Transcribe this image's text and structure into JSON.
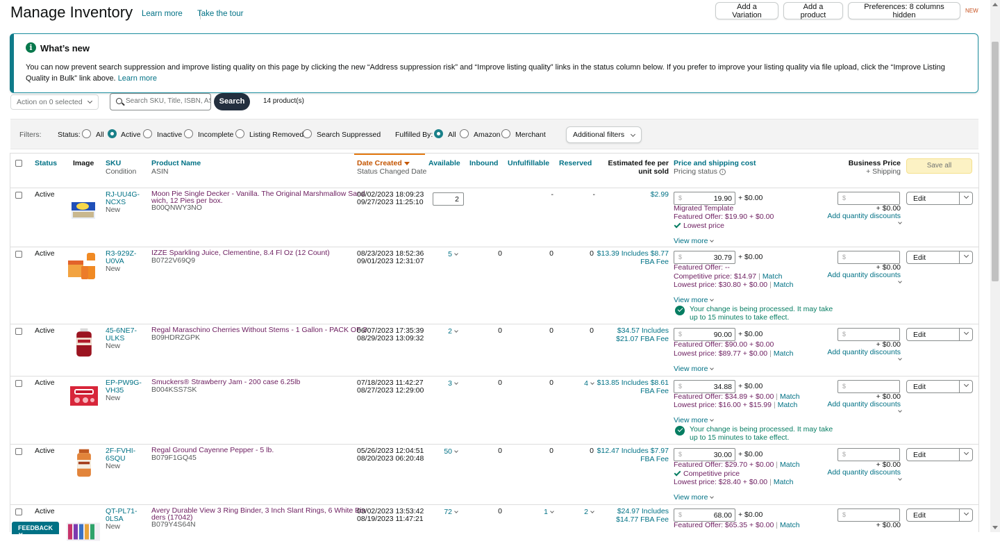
{
  "header": {
    "title": "Manage Inventory",
    "learn_more": "Learn more",
    "take_tour": "Take the tour",
    "add_variation": "Add a Variation",
    "add_product": "Add a product",
    "preferences": "Preferences: 8 columns hidden",
    "new_badge": "NEW"
  },
  "whats_new": {
    "title": "What’s new",
    "body": "You can now prevent search suppression and improve listing quality on this page by clicking the new “Address suppression risk” and “Improve listing quality” links in the status column below. If you prefer to improve your listing quality via file upload, click the “Improve Listing Quality in Bulk” link above.",
    "learn_more": "Learn more"
  },
  "toolbar": {
    "action_select": "Action on 0 selected",
    "search_placeholder": "Search SKU, Title, ISBN, ASIN",
    "search_button": "Search",
    "product_count": "14 product(s)"
  },
  "filters": {
    "label": "Filters:",
    "status_label": "Status:",
    "status_options": [
      "All",
      "Active",
      "Inactive",
      "Incomplete",
      "Listing Removed",
      "Search Suppressed"
    ],
    "status_selected": "Active",
    "fulfilled_label": "Fulfilled By:",
    "fulfilled_options": [
      "All",
      "Amazon",
      "Merchant"
    ],
    "fulfilled_selected": "All",
    "additional_filters": "Additional filters"
  },
  "table": {
    "headers": {
      "status": "Status",
      "image": "Image",
      "sku": "SKU",
      "sku_sub": "Condition",
      "product_name": "Product Name",
      "product_sub": "ASIN",
      "date_created": "Date Created",
      "date_sub": "Status Changed Date",
      "available": "Available",
      "inbound": "Inbound",
      "unfulfillable": "Unfulfillable",
      "reserved": "Reserved",
      "fee_line1": "Estimated fee per",
      "fee_line2": "unit sold",
      "price": "Price and shipping cost",
      "price_sub": "Pricing status",
      "business_price": "Business Price",
      "business_sub": "+ Shipping",
      "save_all": "Save all"
    },
    "rows": [
      {
        "status": "Active",
        "sku1": "RJ-UU4G-",
        "sku2": "NCXS",
        "condition": "New",
        "name1": "Moon Pie Single Decker - Vanilla. The Original Marshmallow Sand",
        "name2": "wich, 12 Pies per box.",
        "asin": "B00QNWY3NO",
        "date_created": "08/02/2023 18:09:23",
        "date_changed": "09/27/2023 11:25:10",
        "available": "2",
        "inbound": "",
        "unfulfillable": "-",
        "reserved": "-",
        "fee1": "$2.99",
        "fee2": "",
        "price": "19.90",
        "shipping": "+ $0.00",
        "line1": "Migrated Template",
        "line2": "Featured Offer: $19.90 + $0.00",
        "line3": "Lowest price",
        "view_more": "View more",
        "business_shipping": "+ $0.00",
        "add_qty": "Add quantity discounts",
        "edit": "Edit"
      },
      {
        "status": "Active",
        "sku1": "R3-929Z-",
        "sku2": "U0VA",
        "condition": "New",
        "name1": "IZZE Sparkling Juice, Clementine, 8.4 Fl Oz (12 Count)",
        "name2": "",
        "asin": "B0722V69Q9",
        "date_created": "08/23/2023 18:52:36",
        "date_changed": "09/01/2023 12:31:07",
        "available": "5",
        "inbound": "0",
        "unfulfillable": "0",
        "reserved": "0",
        "fee1": "$13.39 Includes $8.77",
        "fee2": "FBA Fee",
        "price": "30.79",
        "shipping": "+ $0.00",
        "line1": "Featured Offer: --",
        "line2": "Competitive price: $14.97",
        "line3": "Lowest price: $30.80 + $0.00",
        "match": "Match",
        "view_more": "View more",
        "processing1": "Your change is being processed. It may take",
        "processing2": "up to 15 minutes to take effect.",
        "business_shipping": "+ $0.00",
        "add_qty": "Add quantity discounts",
        "edit": "Edit"
      },
      {
        "status": "Active",
        "sku1": "45-6NE7-",
        "sku2": "ULKS",
        "condition": "New",
        "name1": "Regal Maraschino Cherries Without Stems - 1 Gallon - PACK OF 3",
        "name2": "",
        "asin": "B09HDRZGPK",
        "date_created": "06/07/2023 17:35:39",
        "date_changed": "08/29/2023 13:09:32",
        "available": "2",
        "inbound": "0",
        "unfulfillable": "0",
        "reserved": "0",
        "fee1": "$34.57 Includes",
        "fee2": "$21.07 FBA Fee",
        "price": "90.00",
        "shipping": "+ $0.00",
        "line1": "Featured Offer: $90.00 + $0.00",
        "line2": "Lowest price: $89.77 + $0.00",
        "match": "Match",
        "view_more": "View more",
        "business_shipping": "+ $0.00",
        "add_qty": "Add quantity discounts",
        "edit": "Edit"
      },
      {
        "status": "Active",
        "sku1": "EP-PW9G-",
        "sku2": "VH35",
        "condition": "New",
        "name1": "Smuckers® Strawberry Jam - 200 case 6.25lb",
        "name2": "",
        "asin": "B004KSS7SK",
        "date_created": "07/18/2023 11:42:27",
        "date_changed": "08/27/2023 12:29:00",
        "available": "3",
        "inbound": "0",
        "unfulfillable": "0",
        "reserved": "4",
        "fee1": "$13.85 Includes $8.61",
        "fee2": "FBA Fee",
        "price": "34.88",
        "shipping": "+ $0.00",
        "line1": "Featured Offer: $34.89 + $0.00",
        "line2": "Lowest price: $16.00 + $15.99",
        "match": "Match",
        "view_more": "View more",
        "processing1": "Your change is being processed. It may take",
        "processing2": "up to 15 minutes to take effect.",
        "business_shipping": "+ $0.00",
        "add_qty": "Add quantity discounts",
        "edit": "Edit"
      },
      {
        "status": "Active",
        "sku1": "2F-FVHI-",
        "sku2": "6SQU",
        "condition": "New",
        "name1": "Regal Ground Cayenne Pepper - 5 lb.",
        "name2": "",
        "asin": "B079F1GQ45",
        "date_created": "05/26/2023 12:04:51",
        "date_changed": "08/20/2023 06:20:48",
        "available": "50",
        "inbound": "0",
        "unfulfillable": "0",
        "reserved": "0",
        "fee1": "$12.47 Includes $7.97",
        "fee2": "FBA Fee",
        "price": "30.00",
        "shipping": "+ $0.00",
        "line1": "Featured Offer: $29.70 + $0.00",
        "line2": "Competitive price",
        "line3": "Lowest price: $28.40 + $0.00",
        "match": "Match",
        "view_more": "View more",
        "business_shipping": "+ $0.00",
        "add_qty": "Add quantity discounts",
        "edit": "Edit"
      },
      {
        "status": "Active",
        "sku1": "QT-PL71-",
        "sku2": "0LSA",
        "condition": "New",
        "name1": "Avery Durable View 3 Ring Binder, 3 Inch Slant Rings, 6 White Bin",
        "name2": "ders (17042)",
        "asin": "B079Y4S64N",
        "date_created": "03/02/2023 13:53:42",
        "date_changed": "08/19/2023 11:47:21",
        "available": "72",
        "inbound": "0",
        "unfulfillable": "1",
        "reserved": "2",
        "fee1": "$24.97 Includes",
        "fee2": "$14.77 FBA Fee",
        "price": "68.00",
        "shipping": "+ $0.00",
        "line1": "Featured Offer: $65.35 + $0.00",
        "match": "Match",
        "business_shipping": "+ $0.00",
        "edit": "Edit"
      }
    ]
  },
  "feedback": "FEEDBACK"
}
